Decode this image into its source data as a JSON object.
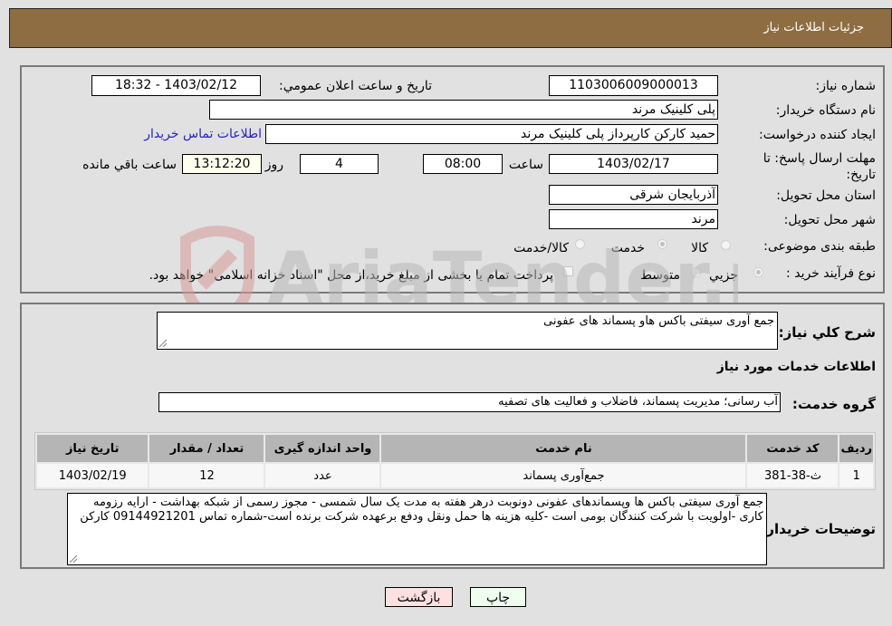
{
  "header": {
    "title": "جزئیات اطلاعات نیاز"
  },
  "fields": {
    "need_number": {
      "label": "شماره نیاز:",
      "value": "1103006009000013"
    },
    "announce": {
      "label": "تاریخ و ساعت اعلان عمومي:",
      "value": "1403/02/12 - 18:32"
    },
    "buyer_org": {
      "label": "نام دستگاه خریدار:",
      "value": "پلی کلینیک مرند"
    },
    "creator": {
      "label": "ایجاد کننده درخواست:",
      "value": "حمید کارکن کارپرداز پلی کلینیک مرند"
    },
    "buyer_contact_link": "اطلاعات تماس خریدار",
    "deadline": {
      "label": "مهلت ارسال پاسخ: تا تاریخ:",
      "date": "1403/02/17",
      "time_label": "ساعت",
      "time": "08:00",
      "days": "4",
      "days_label": "روز و",
      "remaining": "13:12:20",
      "remaining_label": "ساعت باقي مانده"
    },
    "province": {
      "label": "استان محل تحویل:",
      "value": "آذربایجان شرقی"
    },
    "city": {
      "label": "شهر محل تحویل:",
      "value": "مرند"
    },
    "category": {
      "label": "طبقه بندی موضوعی:",
      "options": [
        "کالا",
        "خدمت",
        "کالا/خدمت"
      ],
      "selected": "خدمت"
    },
    "process": {
      "label": "نوع فرآیند خرید :",
      "options": [
        "جزيي",
        "متوسط"
      ],
      "selected": "جزيي",
      "treasury_note": "پرداخت تمام یا بخشی از مبلغ خرید،از محل \"اسناد خزانه اسلامی\" خواهد بود."
    }
  },
  "details": {
    "summary_label": "شرح كلي نياز:",
    "summary": "جمع آوری سیفتی باکس هاو پسماند های عفونی",
    "services_heading": "اطلاعات خدمات مورد نیاز",
    "service_group_label": "گروه خدمت:",
    "service_group": "آب رسانی؛ مدیریت پسماند، فاضلاب و فعالیت های تصفیه",
    "table": {
      "headers": [
        "ردیف",
        "کد خدمت",
        "نام خدمت",
        "واحد اندازه گیری",
        "تعداد / مقدار",
        "تاریخ نیاز"
      ],
      "rows": [
        [
          "1",
          "ث-38-381",
          "جمع‌آوری پسماند",
          "عدد",
          "12",
          "1403/02/19"
        ]
      ]
    },
    "buyer_notes_label": "توضیحات خریدار:",
    "buyer_notes": "جمع آوری سیفتی باکس ها وپسماندهای عفونی دونوبت درهر هفته به مدت یک سال شمسی - مجوز رسمی از شبکه بهداشت - ارایه رزومه کاری -اولویت با شرکت کنندگان بومی است -کلیه هزینه ها حمل ونقل ودفع برعهده شرکت برنده است-شماره تماس 09144921201 کارکن"
  },
  "buttons": {
    "print": "چاپ",
    "back": "بازگشت"
  },
  "watermark": {
    "text": "AriaTender.neT"
  }
}
